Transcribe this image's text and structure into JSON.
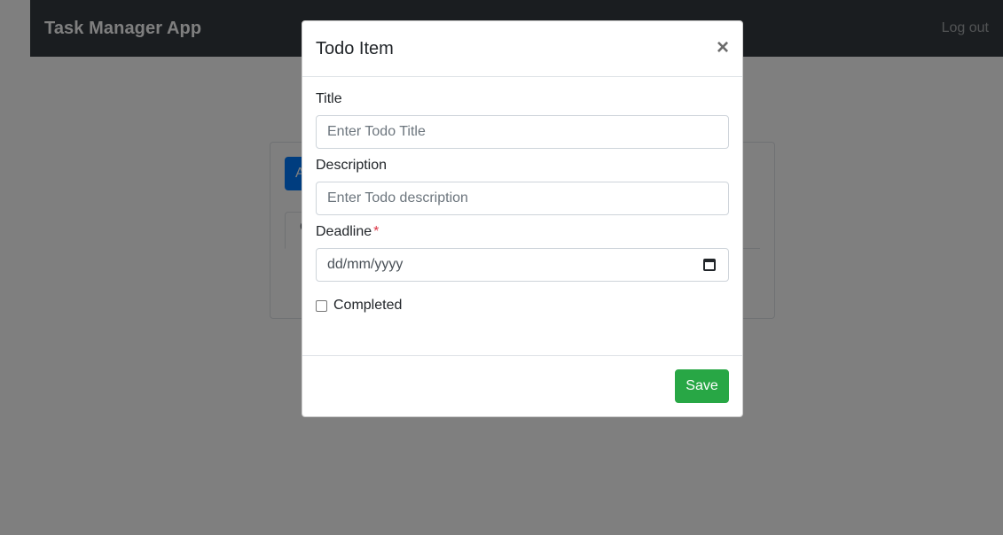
{
  "navbar": {
    "brand": "Task Manager App",
    "logout_label": "Log out"
  },
  "background": {
    "add_button_label": "A",
    "tab_label": "C"
  },
  "modal": {
    "title": "Todo Item",
    "close_icon": "close-icon",
    "fields": {
      "title": {
        "label": "Title",
        "placeholder": "Enter Todo Title",
        "value": ""
      },
      "description": {
        "label": "Description",
        "placeholder": "Enter Todo description",
        "value": ""
      },
      "deadline": {
        "label": "Deadline",
        "required_mark": "*",
        "placeholder": "dd/mm/yyyy",
        "icon": "calendar-icon"
      },
      "completed": {
        "label": "Completed",
        "checked": false
      }
    },
    "save_label": "Save"
  },
  "colors": {
    "navbar": "#343a40",
    "primary": "#007bff",
    "success": "#28a745",
    "required": "#dc3545"
  }
}
